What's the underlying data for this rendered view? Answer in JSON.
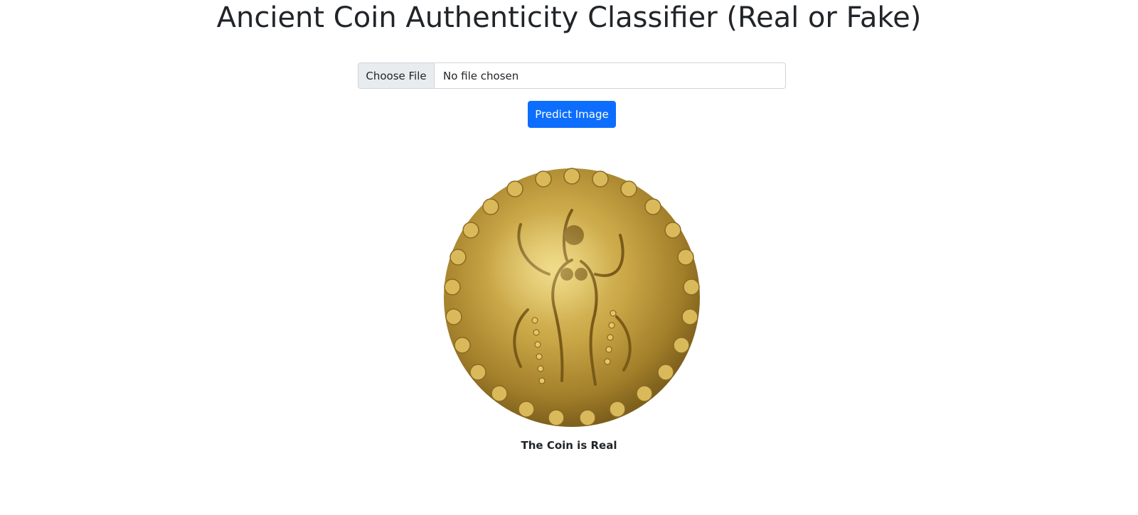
{
  "header": {
    "title": "Ancient Coin Authenticity Classifier (Real or Fake)"
  },
  "upload": {
    "choose_label": "Choose File",
    "status_text": "No file chosen"
  },
  "actions": {
    "predict_label": "Predict Image"
  },
  "preview": {
    "image_name": "gold-coin-image",
    "accent_color": "#c9a646"
  },
  "result": {
    "text": "The Coin is Real"
  }
}
